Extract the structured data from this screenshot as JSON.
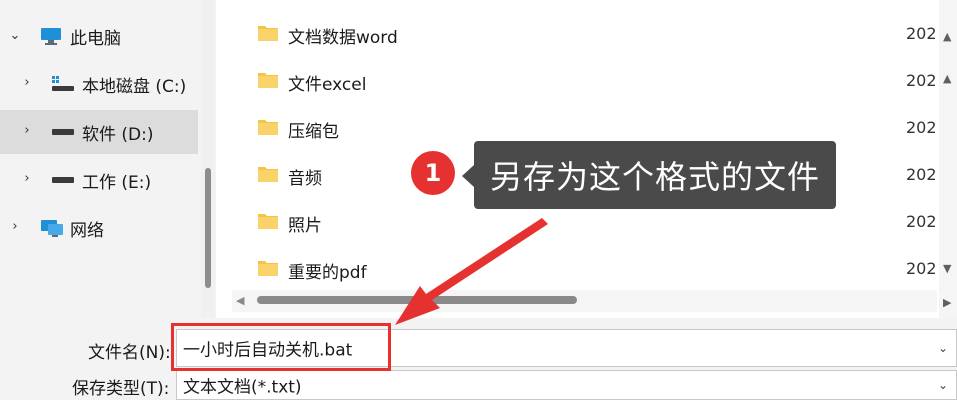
{
  "navigation": {
    "items": [
      {
        "label": "此电脑",
        "icon": "monitor-icon",
        "expanded": true
      },
      {
        "label": "本地磁盘 (C:)",
        "icon": "system-drive-icon",
        "expanded": false
      },
      {
        "label": "软件 (D:)",
        "icon": "drive-icon",
        "expanded": false,
        "selected": true
      },
      {
        "label": "工作 (E:)",
        "icon": "drive-icon",
        "expanded": false
      },
      {
        "label": "网络",
        "icon": "network-icon",
        "expanded": false
      }
    ]
  },
  "files": [
    {
      "name": "文档数据word",
      "date": "202"
    },
    {
      "name": "文件excel",
      "date": "202"
    },
    {
      "name": "压缩包",
      "date": "202"
    },
    {
      "name": "音频",
      "date": "202"
    },
    {
      "name": "照片",
      "date": "202"
    },
    {
      "name": "重要的pdf",
      "date": "202"
    }
  ],
  "form": {
    "filename_label": "文件名(N):",
    "filename_value": "一小时后自动关机.bat",
    "filetype_label": "保存类型(T):",
    "filetype_value": "文本文档(*.txt)"
  },
  "annotation": {
    "badge_number": "1",
    "callout_text": "另存为这个格式的文件"
  },
  "colors": {
    "accent_red": "#e5312f",
    "folder_yellow": "#f6c445",
    "tooltip_bg": "#4a4a4a",
    "selected_bg": "#dcdcdc"
  }
}
